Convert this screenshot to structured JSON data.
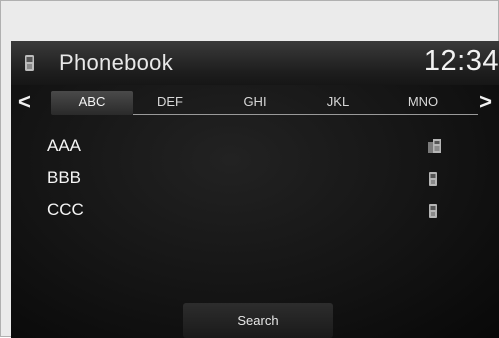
{
  "header": {
    "title": "Phonebook",
    "clock": "12:34",
    "icon": "phone-icon"
  },
  "tabs": [
    {
      "label": "ABC",
      "active": true
    },
    {
      "label": "DEF",
      "active": false
    },
    {
      "label": "GHI",
      "active": false
    },
    {
      "label": "JKL",
      "active": false
    },
    {
      "label": "MNO",
      "active": false
    }
  ],
  "nav": {
    "prev_symbol": "<",
    "next_symbol": ">"
  },
  "contacts": [
    {
      "name": "AAA",
      "icon": "multi-phone-icon"
    },
    {
      "name": "BBB",
      "icon": "phone-icon"
    },
    {
      "name": "CCC",
      "icon": "phone-icon"
    }
  ],
  "search": {
    "label": "Search"
  },
  "colors": {
    "screen_bg": "#141414",
    "text": "#f0f0f0",
    "frame": "#ebebeb"
  }
}
